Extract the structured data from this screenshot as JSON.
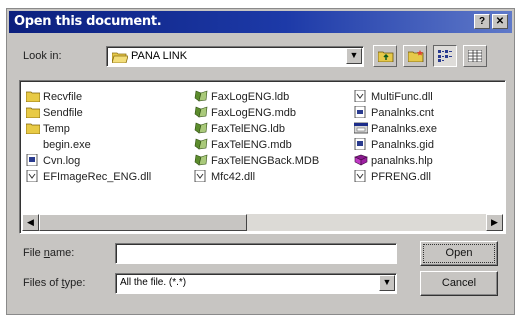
{
  "window": {
    "title": "Open this document.",
    "help_label": "?",
    "close_label": "✕"
  },
  "look_in": {
    "label": "Look in:",
    "value": "PANA LINK"
  },
  "files": {
    "col1": [
      {
        "name": "Recvfile",
        "icon": "folder-icon"
      },
      {
        "name": "Sendfile",
        "icon": "folder-icon"
      },
      {
        "name": "Temp",
        "icon": "folder-icon"
      },
      {
        "name": "begin.exe",
        "icon": "none"
      },
      {
        "name": "Cvn.log",
        "icon": "log-file-icon"
      },
      {
        "name": "EFImageRec_ENG.dll",
        "icon": "dll-file-icon"
      }
    ],
    "col2": [
      {
        "name": "FaxLogENG.ldb",
        "icon": "access-db-icon"
      },
      {
        "name": "FaxLogENG.mdb",
        "icon": "access-db-icon"
      },
      {
        "name": "FaxTelENG.ldb",
        "icon": "access-db-icon"
      },
      {
        "name": "FaxTelENG.mdb",
        "icon": "access-db-icon"
      },
      {
        "name": "FaxTelENGBack.MDB",
        "icon": "access-db-icon"
      },
      {
        "name": "Mfc42.dll",
        "icon": "dll-file-icon"
      }
    ],
    "col3": [
      {
        "name": "MultiFunc.dll",
        "icon": "dll-file-icon"
      },
      {
        "name": "Panalnks.cnt",
        "icon": "help-contents-icon"
      },
      {
        "name": "Panalnks.exe",
        "icon": "application-icon"
      },
      {
        "name": "Panalnks.gid",
        "icon": "help-index-icon"
      },
      {
        "name": "panalnks.hlp",
        "icon": "help-book-icon"
      },
      {
        "name": "PFRENG.dll",
        "icon": "dll-file-icon"
      }
    ]
  },
  "file_name": {
    "label": "File name:",
    "underline_char": "n",
    "value": ""
  },
  "file_type": {
    "label": "Files of type:",
    "value": "All the file. (*.*)"
  },
  "buttons": {
    "open": "Open",
    "cancel": "Cancel"
  },
  "colors": {
    "title_start": "#0b1f7d",
    "title_end": "#5f79c9",
    "face": "#c7c5c2"
  }
}
